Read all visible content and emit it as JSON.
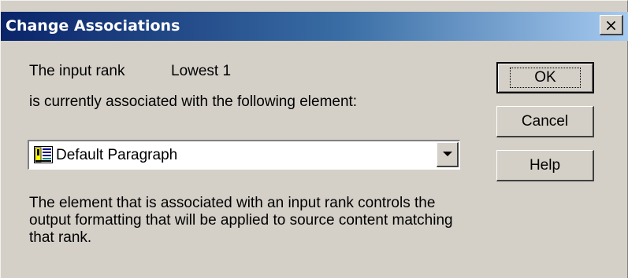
{
  "dialog": {
    "title": "Change Associations",
    "close_symbol": "×"
  },
  "content": {
    "rank_label": "The input rank",
    "rank_value": "Lowest 1",
    "association_text": "is currently associated with the following element:",
    "element_select": {
      "value": "Default Paragraph",
      "icon": "paragraph-style-icon"
    },
    "description": "The element that is associated with an input rank controls the output formatting that will be applied to source content matching that rank."
  },
  "buttons": {
    "ok": "OK",
    "cancel": "Cancel",
    "help": "Help"
  },
  "colors": {
    "titlebar_start": "#0a246a",
    "titlebar_end": "#a6caf0",
    "dialog_face": "#d4d0c8"
  }
}
